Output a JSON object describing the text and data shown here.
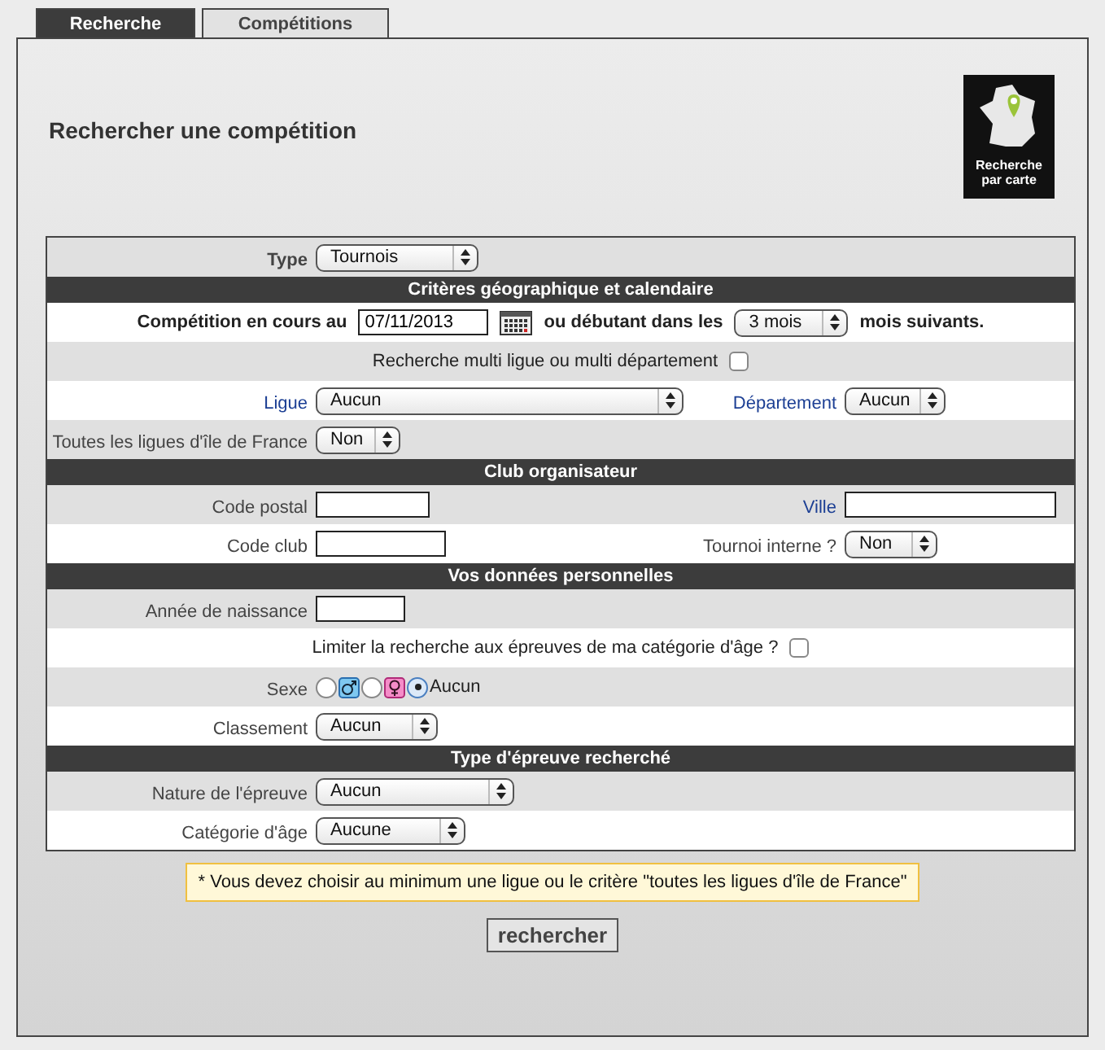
{
  "tabs": [
    {
      "label": "Recherche",
      "selected": true
    },
    {
      "label": "Compétitions",
      "selected": false
    }
  ],
  "title": "Rechercher une compétition",
  "map_button": {
    "label": "Recherche par carte"
  },
  "sections": [
    {
      "rows": [
        {
          "kind": "fields",
          "fields": [
            {
              "label": "Type",
              "strong": true,
              "control": {
                "kind": "select",
                "value": "Tournois"
              }
            }
          ]
        }
      ]
    },
    {
      "title": "Critères géographique et calendaire",
      "rows": [
        {
          "kind": "inline",
          "items": [
            {
              "kind": "text",
              "text": "Compétition en cours au",
              "strong": true
            },
            {
              "kind": "date",
              "value": "07/11/2013"
            },
            {
              "kind": "text",
              "text": "ou débutant dans les",
              "strong": true
            },
            {
              "kind": "select",
              "value": "3 mois"
            },
            {
              "kind": "text",
              "text": "mois suivants.",
              "strong": true
            }
          ]
        },
        {
          "kind": "inline",
          "items": [
            {
              "kind": "text",
              "text": "Recherche multi ligue ou multi département",
              "strong": false
            },
            {
              "kind": "checkbox",
              "checked": false
            }
          ]
        },
        {
          "kind": "fields",
          "fields": [
            {
              "label": "Ligue",
              "required": true,
              "control": {
                "kind": "select",
                "value": "Aucun"
              }
            },
            {
              "label": "Département",
              "required": true,
              "control": {
                "kind": "select",
                "value": "Aucun"
              }
            }
          ]
        },
        {
          "kind": "fields",
          "fields": [
            {
              "label": "Toutes les ligues d'île de France",
              "control": {
                "kind": "select",
                "value": "Non"
              }
            }
          ]
        }
      ]
    },
    {
      "title": "Club organisateur",
      "rows": [
        {
          "kind": "fields",
          "fields": [
            {
              "label": "Code postal",
              "control": {
                "kind": "input"
              }
            },
            {
              "label": "Ville",
              "required": true,
              "control": {
                "kind": "input"
              }
            }
          ]
        },
        {
          "kind": "fields",
          "fields": [
            {
              "label": "Code club",
              "control": {
                "kind": "input"
              }
            },
            {
              "label": "Tournoi interne ?",
              "control": {
                "kind": "select",
                "value": "Non"
              }
            }
          ]
        }
      ]
    },
    {
      "title": "Vos données personnelles",
      "rows": [
        {
          "kind": "fields",
          "fields": [
            {
              "label": "Année de naissance",
              "control": {
                "kind": "input"
              }
            }
          ]
        },
        {
          "kind": "inline",
          "items": [
            {
              "kind": "text",
              "text": "Limiter la recherche aux épreuves de ma catégorie d'âge ?",
              "strong": false
            },
            {
              "kind": "checkbox",
              "checked": false
            }
          ]
        },
        {
          "kind": "fields",
          "fields": [
            {
              "label": "Sexe",
              "control": {
                "kind": "radios",
                "options": [
                  {
                    "kind": "male",
                    "selected": false
                  },
                  {
                    "kind": "female",
                    "selected": false
                  },
                  {
                    "kind": "label",
                    "label": "Aucun",
                    "selected": true
                  }
                ]
              }
            }
          ]
        },
        {
          "kind": "fields",
          "fields": [
            {
              "label": "Classement",
              "control": {
                "kind": "select",
                "value": "Aucun"
              }
            }
          ]
        }
      ]
    },
    {
      "title": "Type d'épreuve recherché",
      "rows": [
        {
          "kind": "fields",
          "fields": [
            {
              "label": "Nature de l'épreuve",
              "control": {
                "kind": "select",
                "value": "Aucun"
              }
            }
          ]
        },
        {
          "kind": "fields",
          "fields": [
            {
              "label": "Catégorie d'âge",
              "control": {
                "kind": "select",
                "value": "Aucune"
              }
            }
          ]
        }
      ]
    }
  ],
  "notice": "* Vous devez choisir au minimum une ligue ou le critère \"toutes les ligues d'île de France\"",
  "submit": "rechercher"
}
